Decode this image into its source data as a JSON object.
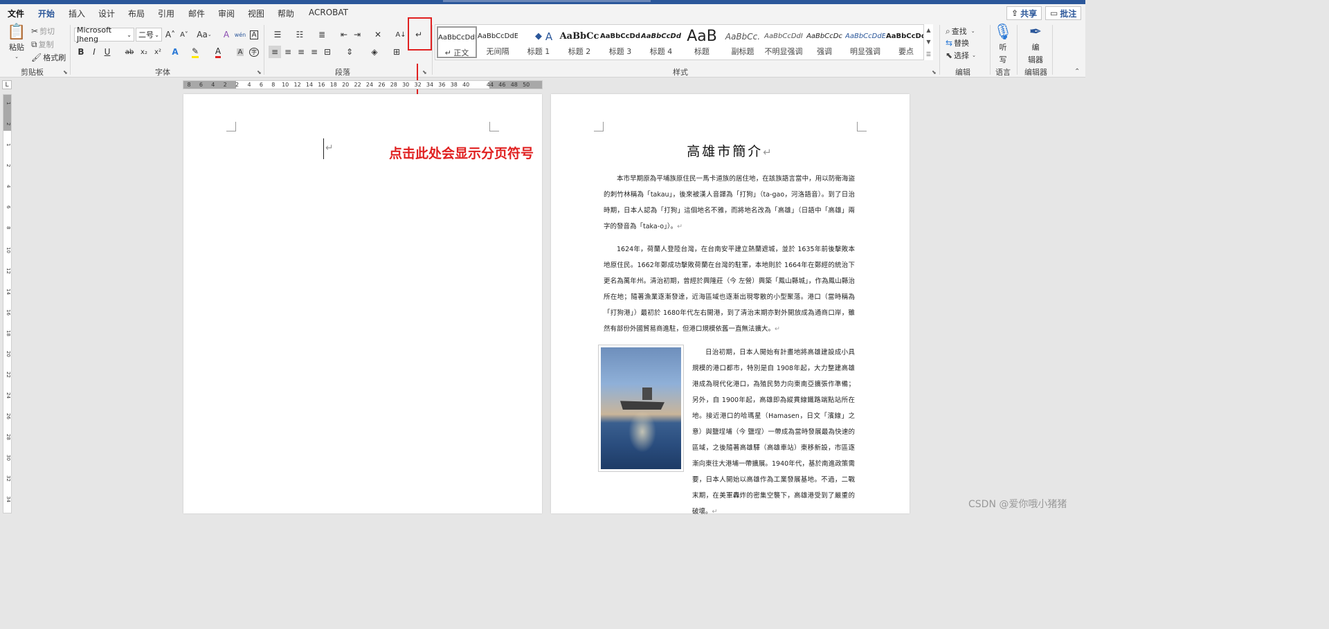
{
  "menu": {
    "tabs": [
      "文件",
      "开始",
      "插入",
      "设计",
      "布局",
      "引用",
      "邮件",
      "审阅",
      "视图",
      "帮助",
      "ACROBAT"
    ],
    "share_label": "共享",
    "comment_label": "批注"
  },
  "clipboard": {
    "paste_label": "粘贴",
    "cut_label": "剪切",
    "copy_label": "复制",
    "format_painter_label": "格式刷",
    "group_label": "剪贴板"
  },
  "font": {
    "font_name": "Microsoft Jheng",
    "font_size": "二号",
    "change_case": "Aa",
    "bold": "B",
    "italic": "I",
    "underline": "U",
    "strike": "ab",
    "subscript": "x₂",
    "superscript": "x²",
    "group_label": "字体"
  },
  "paragraph": {
    "group_label": "段落"
  },
  "styles": {
    "items": [
      {
        "sample": "AaBbCcDdE",
        "name": "↵ 正文"
      },
      {
        "sample": "AaBbCcDdE",
        "name": "无间隔"
      },
      {
        "sample": "◆",
        "name": "标题 1"
      },
      {
        "sample": "AaBbCc",
        "name": "标题 2"
      },
      {
        "sample": "AaBbCcDd",
        "name": "标题 3"
      },
      {
        "sample": "AaBbCcDd",
        "name": "标题 4"
      },
      {
        "sample": "AaB",
        "name": "标题"
      },
      {
        "sample": "AaBbCc.",
        "name": "副标题"
      },
      {
        "sample": "AaBbCcDdI",
        "name": "不明显强调"
      },
      {
        "sample": "AaBbCcDc",
        "name": "强调"
      },
      {
        "sample": "AaBbCcDdE",
        "name": "明显强调"
      },
      {
        "sample": "AaBbCcDdE",
        "name": "要点"
      }
    ],
    "first_style_glyph": "A",
    "group_label": "样式"
  },
  "editing": {
    "find_label": "查找",
    "replace_label": "替换",
    "select_label": "选择",
    "group_label": "编辑"
  },
  "voice": {
    "dictate_label_1": "听",
    "dictate_label_2": "写",
    "group_label": "语言"
  },
  "editor": {
    "editor_label_1": "编",
    "editor_label_2": "辑器",
    "group_label": "编辑器"
  },
  "ruler": {
    "h_ticks": [
      "8",
      "6",
      "4",
      "2",
      "2",
      "4",
      "6",
      "8",
      "10",
      "12",
      "14",
      "16",
      "18",
      "20",
      "22",
      "24",
      "26",
      "28",
      "30",
      "32",
      "34",
      "36",
      "38",
      "40",
      "44",
      "46",
      "48",
      "50"
    ],
    "v_ticks": [
      "1",
      "2",
      "1",
      "2",
      "4",
      "6",
      "8",
      "10",
      "12",
      "14",
      "16",
      "18",
      "20",
      "22",
      "24",
      "26",
      "28",
      "30",
      "32",
      "34"
    ],
    "corner_glyph": "L"
  },
  "annotation": {
    "text": "点击此处会显示分页符号"
  },
  "document": {
    "title": "高雄市簡介",
    "paragraph_mark": "↵",
    "p1": "本市早期原為平埔族原住民一馬卡道族的居住地，在該族語言當中，用以防衛海盜的刺竹林稱為「takau」，後來被漢人音譯為「打狗」（ta-gao，河洛語音）。到了日治時期，日本人認為「打狗」這個地名不雅，而將地名改為「高雄」（日語中「高雄」兩字的發音為「taka-o」）。",
    "p2": "1624年，荷蘭人登陸台灣，在台南安平建立熱蘭遮城，並於 1635年前後擊敗本地原住民。1662年鄭成功擊敗荷蘭在台灣的駐軍，本地則於 1664年在鄭經的統治下更名為萬年州。清治初期，曾經於興隆莊（今 左營）興築「鳳山縣城」，作為鳳山縣治所在地；隨著漁業逐漸發達，近海區域也逐漸出現零散的小型聚落。港口（當時稱為「打狗港」）最初於 1680年代左右開港，到了清治末期亦對外開放成為通商口岸，雖然有部份外國貿易商進駐，但港口規模依舊一直無法擴大。",
    "p3": "日治初期，日本人開始有計畫地將高雄建設成小具規模的港口都市，特別是自 1908年起，大力整建高雄港成為現代化港口，為殖民勢力向東南亞擴張作準備；另外，自 1900年起，高雄即為縱貫線鐵路端點站所在地。接近港口的哈瑪星（Hamasen，日文「濱線」之意）與鹽埕埔（今 鹽埕）一帶成為當時發展最為快速的區域，之後隨著高雄驛（高雄車站）東移新設，市區逐漸向東往大港埔一帶擴展。1940年代，基於南進政策需要，日本人開始以高雄作為工業發展基地。不過，二戰末期，在美軍轟炸的密集空襲下，高雄港受到了嚴重的破壞。"
  },
  "watermark": "CSDN @爱你哦小猪猪",
  "colors": {
    "accent": "#2b579a",
    "annotation_red": "#e02020"
  }
}
